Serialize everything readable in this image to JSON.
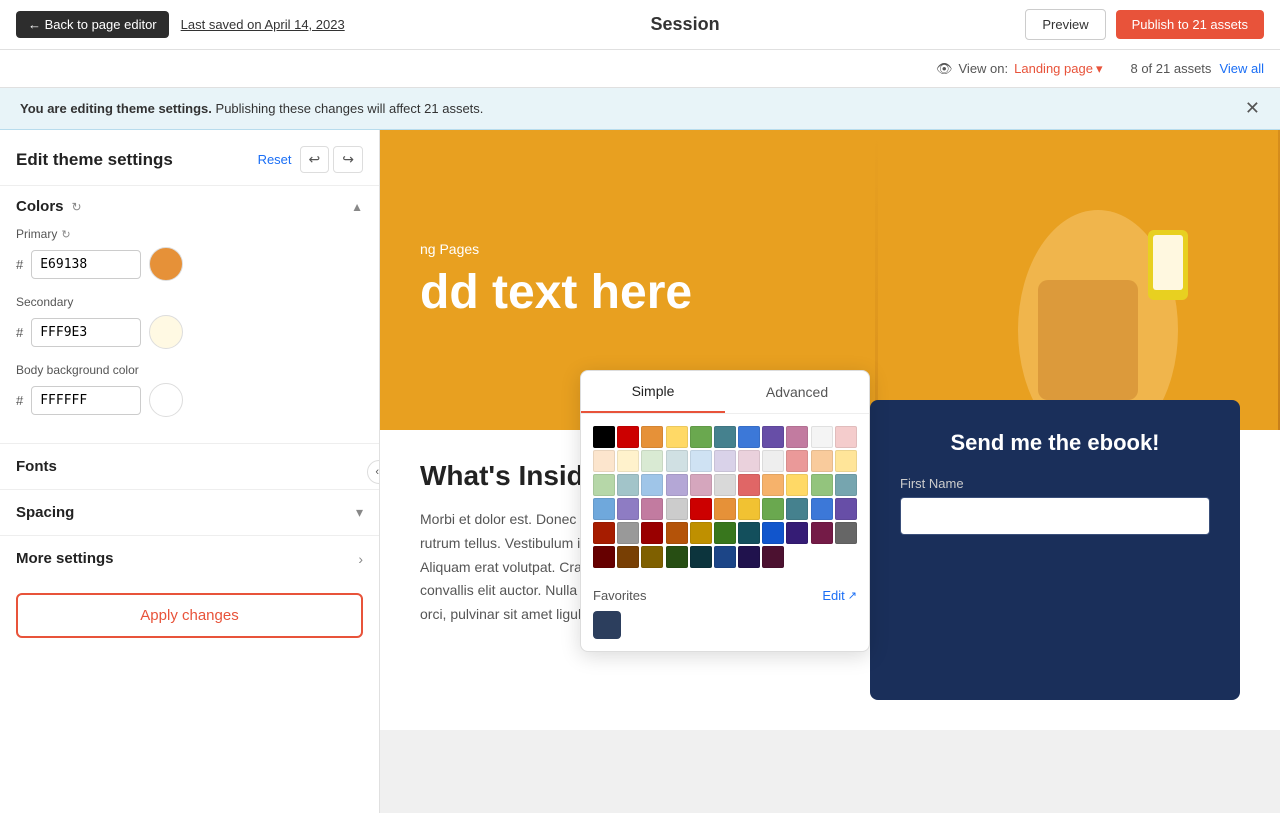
{
  "topbar": {
    "back_label": "← Back to page editor",
    "last_saved": "Last saved on April 14, 2023",
    "page_title": "Session",
    "preview_label": "Preview",
    "publish_label": "Publish to 21 assets"
  },
  "assets_bar": {
    "view_on_label": "View on:",
    "page_type": "Landing page",
    "assets_count": "8 of 21 assets",
    "view_all": "View all"
  },
  "notification": {
    "main": "You are editing theme settings.",
    "sub": "Publishing these changes will affect 21 assets."
  },
  "sidebar": {
    "title": "Edit theme settings",
    "reset_label": "Reset",
    "undo_label": "↩",
    "redo_label": "↪",
    "colors_section": {
      "label": "Colors",
      "primary_label": "Primary",
      "primary_value": "E69138",
      "primary_color": "#e69138",
      "secondary_label": "Secondary",
      "secondary_value": "FFF9E3",
      "secondary_color": "#fff9e3",
      "body_bg_label": "Body background color",
      "body_bg_value": "FFFFFF",
      "body_bg_color": "#ffffff"
    },
    "fonts_section": {
      "label": "Fonts"
    },
    "spacing_section": {
      "label": "Spacing"
    },
    "more_settings_section": {
      "label": "More settings"
    },
    "apply_btn": "Apply changes"
  },
  "color_picker": {
    "simple_tab": "Simple",
    "advanced_tab": "Advanced",
    "favorites_label": "Favorites",
    "edit_label": "Edit",
    "colors": [
      "#000000",
      "#cc0000",
      "#e69138",
      "#ffd966",
      "#6aa84f",
      "#45818e",
      "#3c78d8",
      "#674ea7",
      "#c27ba0",
      "#f4f4f4",
      "#f4cccc",
      "#fce5cd",
      "#fff2cc",
      "#d9ead3",
      "#d0e0e3",
      "#cfe2f3",
      "#d9d2e9",
      "#ead1dc",
      "#eeeeee",
      "#ea9999",
      "#f9cb9c",
      "#ffe599",
      "#b6d7a8",
      "#a2c4c9",
      "#9fc5e8",
      "#b4a7d6",
      "#d5a6bd",
      "#d9d9d9",
      "#e06666",
      "#f6b26b",
      "#ffd966",
      "#93c47d",
      "#76a5af",
      "#6fa8dc",
      "#8e7cc3",
      "#c27ba0",
      "#cccccc",
      "#cc0000",
      "#e69138",
      "#f1c232",
      "#6aa84f",
      "#45818e",
      "#3c78d8",
      "#674ea7",
      "#a61c00",
      "#999999",
      "#990000",
      "#b45309",
      "#bf9000",
      "#38761d",
      "#134f5c",
      "#1155cc",
      "#351c75",
      "#741b47",
      "#666666",
      "#660000",
      "#783f04",
      "#7f6000",
      "#274e13",
      "#0c343d",
      "#1c4587",
      "#20124d",
      "#4c1130"
    ],
    "fav_color": "#2c3e5d"
  },
  "landing_page": {
    "hero_subtitle": "ng Pages",
    "hero_title": "dd text here",
    "content_title": "What's Inside?",
    "content_body": "Morbi et dolor est. Donec at dolor vehicula, molestie erat non, rutrum tellus. Vestibulum in eros non augue convallis pulvinar. Aliquam erat volutpat. Cras interdum felis at sem pharetra, sed convallis elit auctor. Nulla semper ut ante eu dapibus. Mauris dui orci, pulvinar sit amet ligula vel.",
    "signup_title": "Send me the ebook!",
    "first_name_label": "First Name",
    "form_placeholder": ""
  }
}
